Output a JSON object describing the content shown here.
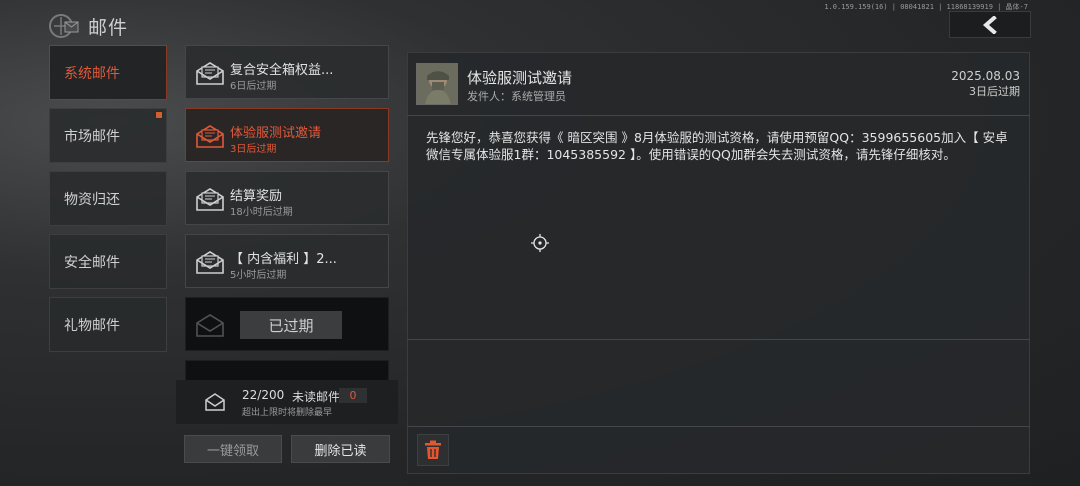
{
  "header": {
    "title": "邮件",
    "version": "1.0.159.159(16) | 08041821 | 11868139919 | 晶体-7",
    "back_icon": "chevron-left-icon"
  },
  "tabs": [
    {
      "label": "系统邮件",
      "active": true,
      "dot": false
    },
    {
      "label": "市场邮件",
      "active": false,
      "dot": true
    },
    {
      "label": "物资归还",
      "active": false,
      "dot": false
    },
    {
      "label": "安全邮件",
      "active": false,
      "dot": false
    },
    {
      "label": "礼物邮件",
      "active": false,
      "dot": false
    }
  ],
  "mails": [
    {
      "title": "复合安全箱权益...",
      "expiry": "6日后过期",
      "state": "normal"
    },
    {
      "title": "体验服测试邀请",
      "expiry": "3日后过期",
      "state": "selected"
    },
    {
      "title": "结算奖励",
      "expiry": "18小时后过期",
      "state": "normal"
    },
    {
      "title": "【 内含福利 】2...",
      "expiry": "5小时后过期",
      "state": "normal"
    },
    {
      "expired_label": "已过期",
      "state": "expired"
    }
  ],
  "counter": {
    "count": "22/200",
    "unread_label": "未读邮件",
    "unread_count": "0",
    "note": "超出上限时将删除最早"
  },
  "buttons": {
    "claim_all": "一键领取",
    "delete_read": "删除已读"
  },
  "detail": {
    "title": "体验服测试邀请",
    "sender": "发件人：系统管理员",
    "date": "2025.08.03",
    "expiry": "3日后过期",
    "body": "先锋您好，恭喜您获得《 暗区突围 》8月体验服的测试资格，请使用预留QQ：3599655605加入【 安卓微信专属体验服1群：1045385592 】。使用错误的QQ加群会失去测试资格，请先锋仔细核对。"
  },
  "colors": {
    "accent": "#e0593a",
    "accent_border": "#8a3a22",
    "trash_icon": "#e2572f"
  }
}
